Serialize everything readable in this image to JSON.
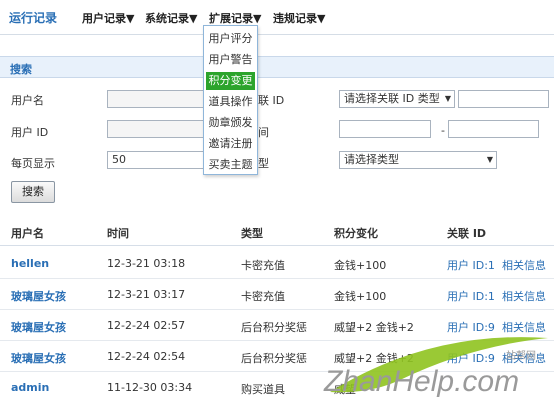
{
  "nav": {
    "title": "运行记录",
    "menus": [
      {
        "label": "用户记录▼"
      },
      {
        "label": "系统记录▼"
      },
      {
        "label": "扩展记录▼"
      },
      {
        "label": "违规记录▼"
      }
    ],
    "dropdown_items": [
      {
        "label": "用户评分",
        "active": false
      },
      {
        "label": "用户警告",
        "active": false
      },
      {
        "label": "积分变更",
        "active": true
      },
      {
        "label": "道具操作",
        "active": false
      },
      {
        "label": "勋章颁发",
        "active": false
      },
      {
        "label": "邀请注册",
        "active": false
      },
      {
        "label": "买卖主题",
        "active": false
      }
    ]
  },
  "search": {
    "title": "搜索",
    "username_label": "用户名",
    "userid_label": "用户 ID",
    "pagesize_label": "每页显示",
    "pagesize_value": "50",
    "related_id_label": "联 ID",
    "related_id_type": "请选择关联 ID 类型",
    "time_label": "间",
    "type_label": "型",
    "type_select": "请选择类型",
    "range_dash": "-",
    "submit_label": "搜索"
  },
  "table": {
    "headers": [
      "用户名",
      "时间",
      "类型",
      "积分变化",
      "关联 ID"
    ],
    "rows": [
      {
        "user": "hellen",
        "time": "12-3-21 03:18",
        "type": "卡密充值",
        "change": "金钱+100",
        "related": "用户 ID:1",
        "info": "相关信息"
      },
      {
        "user": "玻璃屋女孩",
        "time": "12-3-21 03:17",
        "type": "卡密充值",
        "change": "金钱+100",
        "related": "用户 ID:1",
        "info": "相关信息"
      },
      {
        "user": "玻璃屋女孩",
        "time": "12-2-24 02:57",
        "type": "后台积分奖惩",
        "change": "威望+2 金钱+2",
        "related": "用户 ID:9",
        "info": "相关信息"
      },
      {
        "user": "玻璃屋女孩",
        "time": "12-2-24 02:54",
        "type": "后台积分奖惩",
        "change": "威望+2 金钱+2",
        "related": "用户 ID:9",
        "info": "相关信息"
      },
      {
        "user": "admin",
        "time": "11-12-30 03:34",
        "type": "购买道具",
        "change": "威望",
        "related": "",
        "info": ""
      }
    ]
  },
  "watermark": {
    "text": "ZhanHelp.com",
    "subtext": "站帮网",
    "color": "#8fc31f"
  }
}
